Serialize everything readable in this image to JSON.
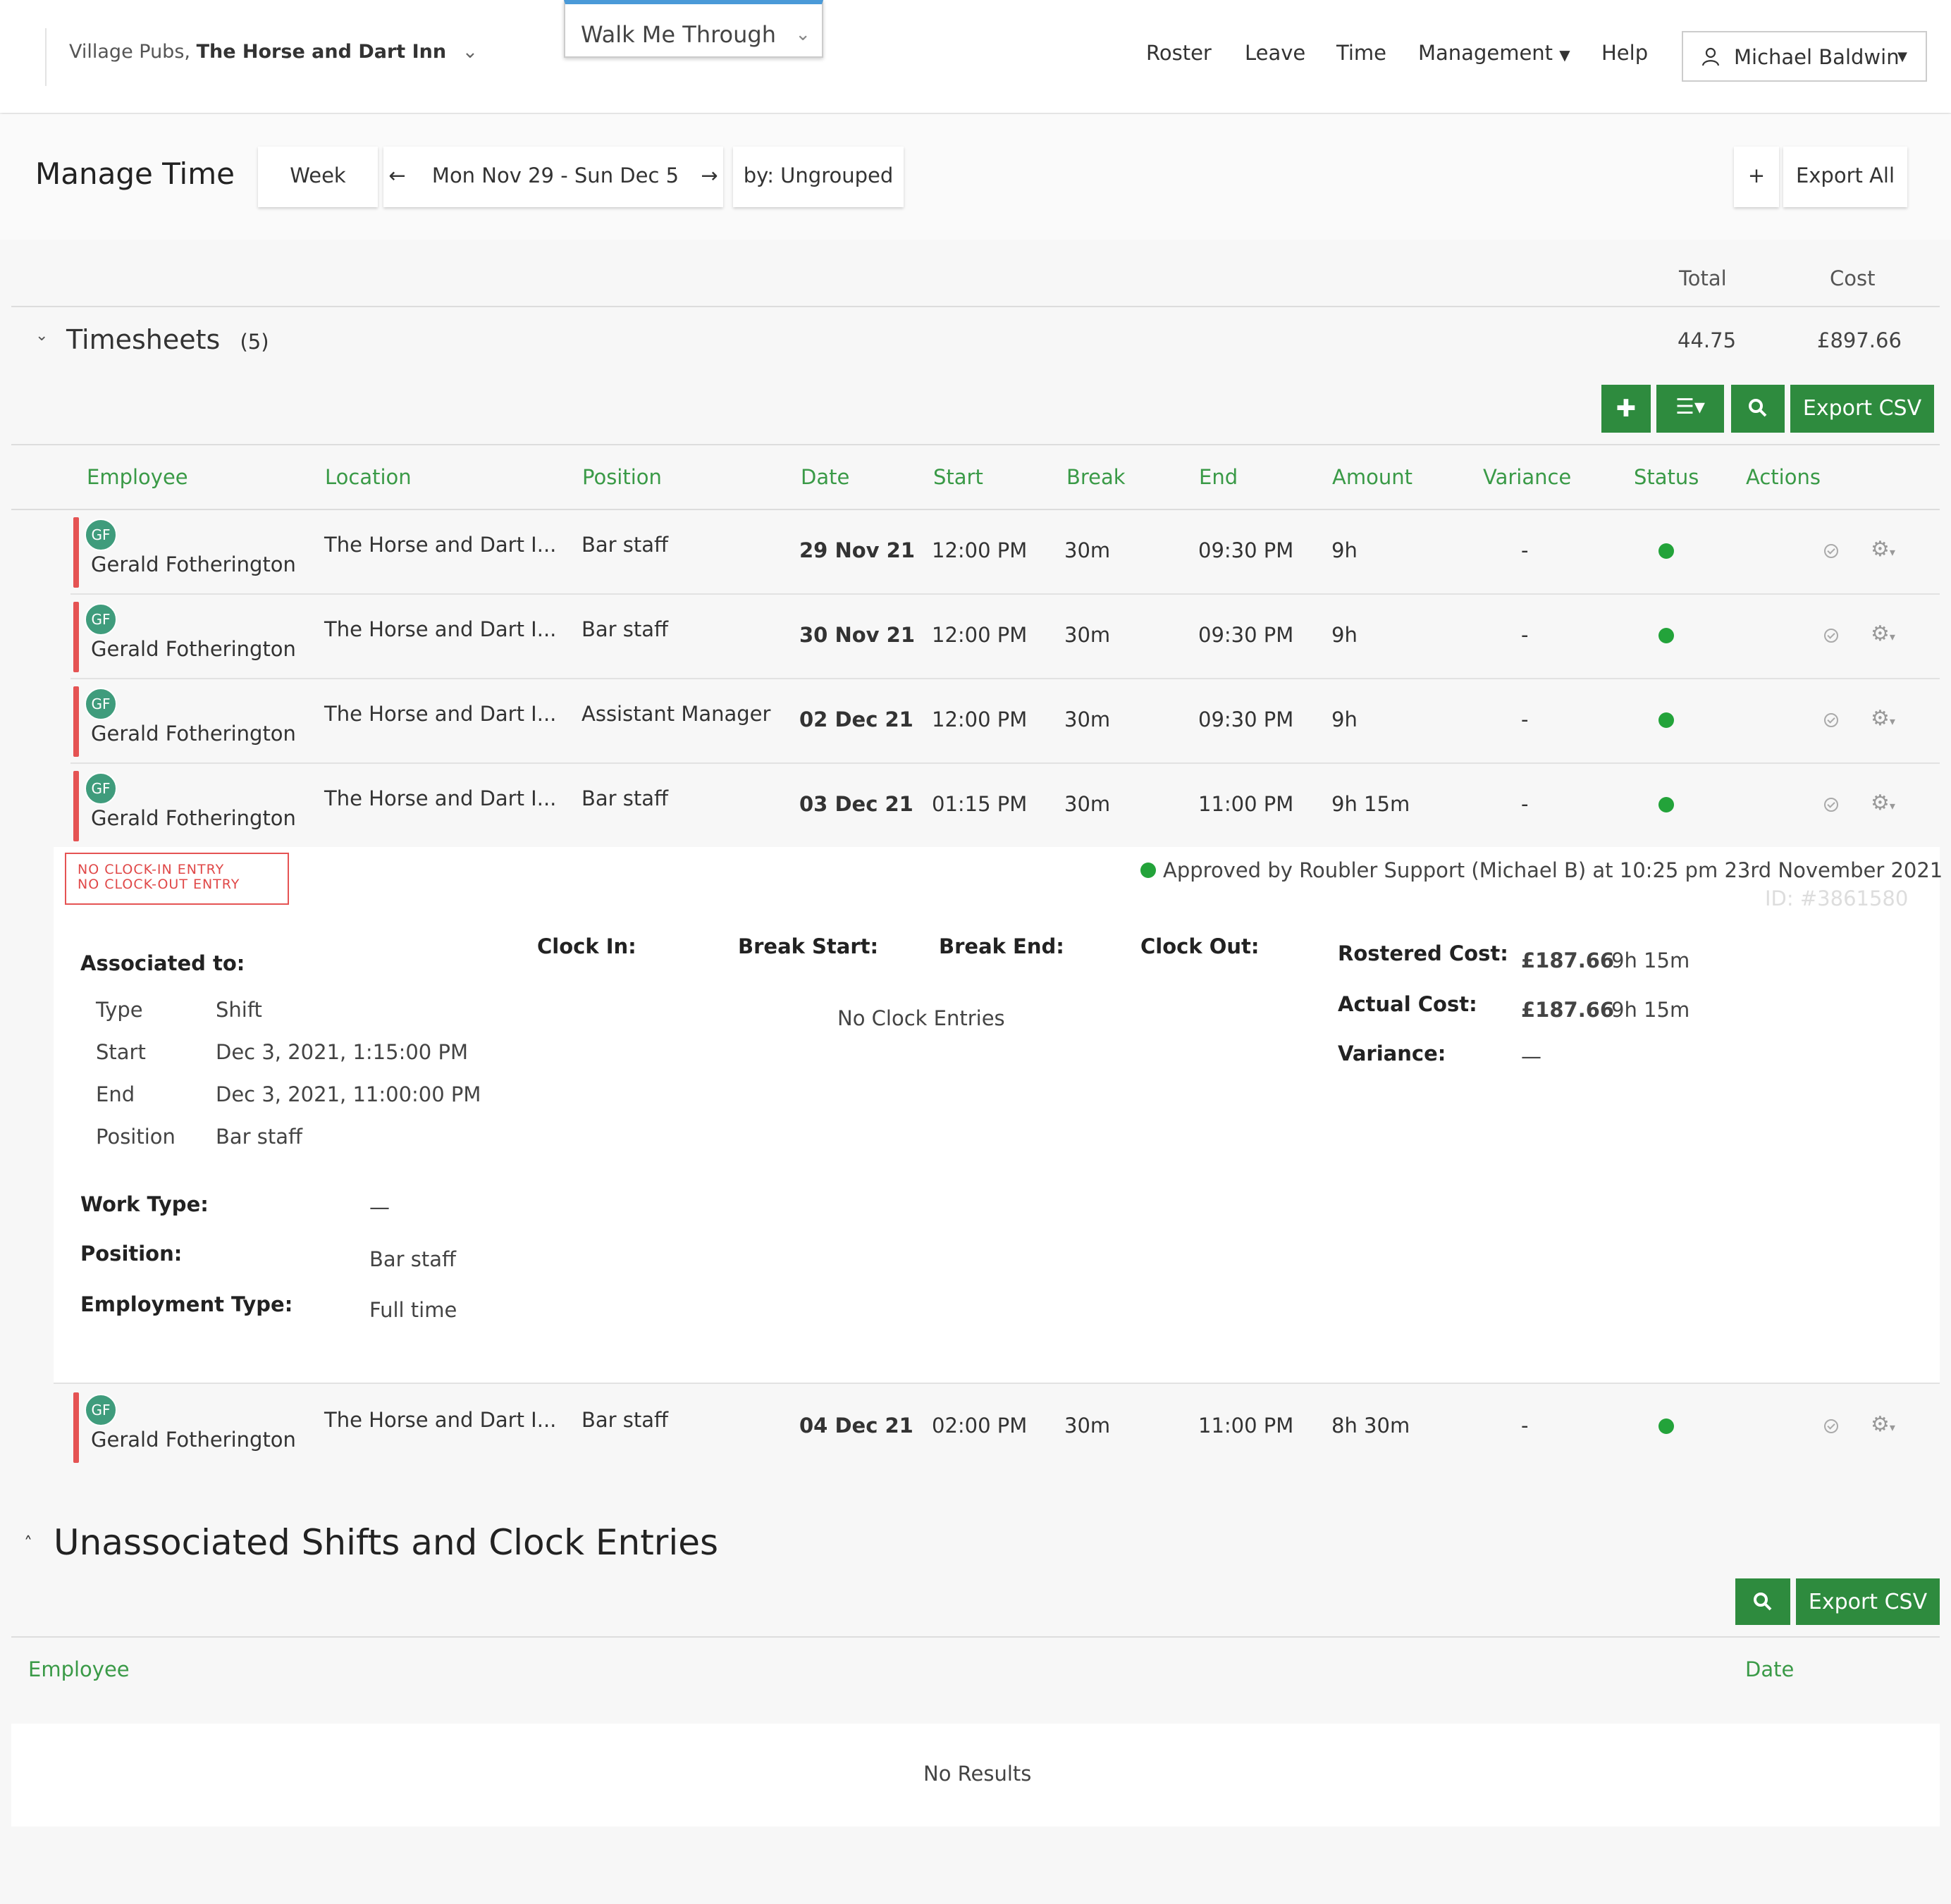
{
  "nav": {
    "venue_prefix": "Village Pubs,",
    "venue_name": "The Horse and Dart Inn",
    "walk_me": "Walk Me Through",
    "items": [
      "Roster",
      "Leave",
      "Time",
      "Management",
      "Help"
    ],
    "user": "Michael Baldwin"
  },
  "toolbar": {
    "title": "Manage Time",
    "week": "Week",
    "date_range": "Mon Nov 29 - Sun Dec 5",
    "group_by": "by: Ungrouped",
    "plus": "+",
    "export_all": "Export All"
  },
  "summary": {
    "total_label": "Total",
    "cost_label": "Cost",
    "section_title": "Timesheets",
    "count": "(5)",
    "total": "44.75",
    "cost": "£897.66"
  },
  "actions": {
    "export_csv": "Export CSV"
  },
  "columns": [
    "Employee",
    "Location",
    "Position",
    "Date",
    "Start",
    "Break",
    "End",
    "Amount",
    "Variance",
    "Status",
    "Actions"
  ],
  "rows": [
    {
      "initials": "GF",
      "employee": "Gerald Fotherington",
      "location": "The Horse and Dart I...",
      "position": "Bar staff",
      "date": "29 Nov 21",
      "start": "12:00 PM",
      "break": "30m",
      "end": "09:30 PM",
      "amount": "9h",
      "variance": "-"
    },
    {
      "initials": "GF",
      "employee": "Gerald Fotherington",
      "location": "The Horse and Dart I...",
      "position": "Bar staff",
      "date": "30 Nov 21",
      "start": "12:00 PM",
      "break": "30m",
      "end": "09:30 PM",
      "amount": "9h",
      "variance": "-"
    },
    {
      "initials": "GF",
      "employee": "Gerald Fotherington",
      "location": "The Horse and Dart I...",
      "position": "Assistant Manager",
      "date": "02 Dec 21",
      "start": "12:00 PM",
      "break": "30m",
      "end": "09:30 PM",
      "amount": "9h",
      "variance": "-"
    },
    {
      "initials": "GF",
      "employee": "Gerald Fotherington",
      "location": "The Horse and Dart I...",
      "position": "Bar staff",
      "date": "03 Dec 21",
      "start": "01:15 PM",
      "break": "30m",
      "end": "11:00 PM",
      "amount": "9h 15m",
      "variance": "-"
    },
    {
      "initials": "GF",
      "employee": "Gerald Fotherington",
      "location": "The Horse and Dart I...",
      "position": "Bar staff",
      "date": "04 Dec 21",
      "start": "02:00 PM",
      "break": "30m",
      "end": "11:00 PM",
      "amount": "8h 30m",
      "variance": "-"
    }
  ],
  "detail": {
    "warn1": "NO CLOCK-IN ENTRY",
    "warn2": "NO CLOCK-OUT ENTRY",
    "approved": "Approved by Roubler Support (Michael B) at 10:25 pm 23rd November 2021",
    "id": "ID: #3861580",
    "associated_label": "Associated to:",
    "assoc": [
      {
        "k": "Type",
        "v": "Shift"
      },
      {
        "k": "Start",
        "v": "Dec 3, 2021, 1:15:00 PM"
      },
      {
        "k": "End",
        "v": "Dec 3, 2021, 11:00:00 PM"
      },
      {
        "k": "Position",
        "v": "Bar staff"
      }
    ],
    "clock_in": "Clock In:",
    "break_start": "Break Start:",
    "break_end": "Break End:",
    "clock_out": "Clock Out:",
    "no_clock": "No Clock Entries",
    "rostered_cost_label": "Rostered Cost:",
    "rostered_cost": "£187.66",
    "rostered_hours": "9h 15m",
    "actual_cost_label": "Actual Cost:",
    "actual_cost": "£187.66",
    "actual_hours": "9h 15m",
    "variance_label": "Variance:",
    "variance": "—",
    "work_type_label": "Work Type:",
    "work_type": "—",
    "position_label": "Position:",
    "position": "Bar staff",
    "employment_type_label": "Employment Type:",
    "employment_type": "Full time"
  },
  "unassociated": {
    "title": "Unassociated Shifts and Clock Entries",
    "export_csv": "Export CSV",
    "col_employee": "Employee",
    "col_date": "Date",
    "no_results": "No Results"
  },
  "colors": {
    "accent_green": "#2e8b3e",
    "header_green": "#3a9a47",
    "warning_red": "#e55353",
    "status_green": "#23a33a"
  }
}
